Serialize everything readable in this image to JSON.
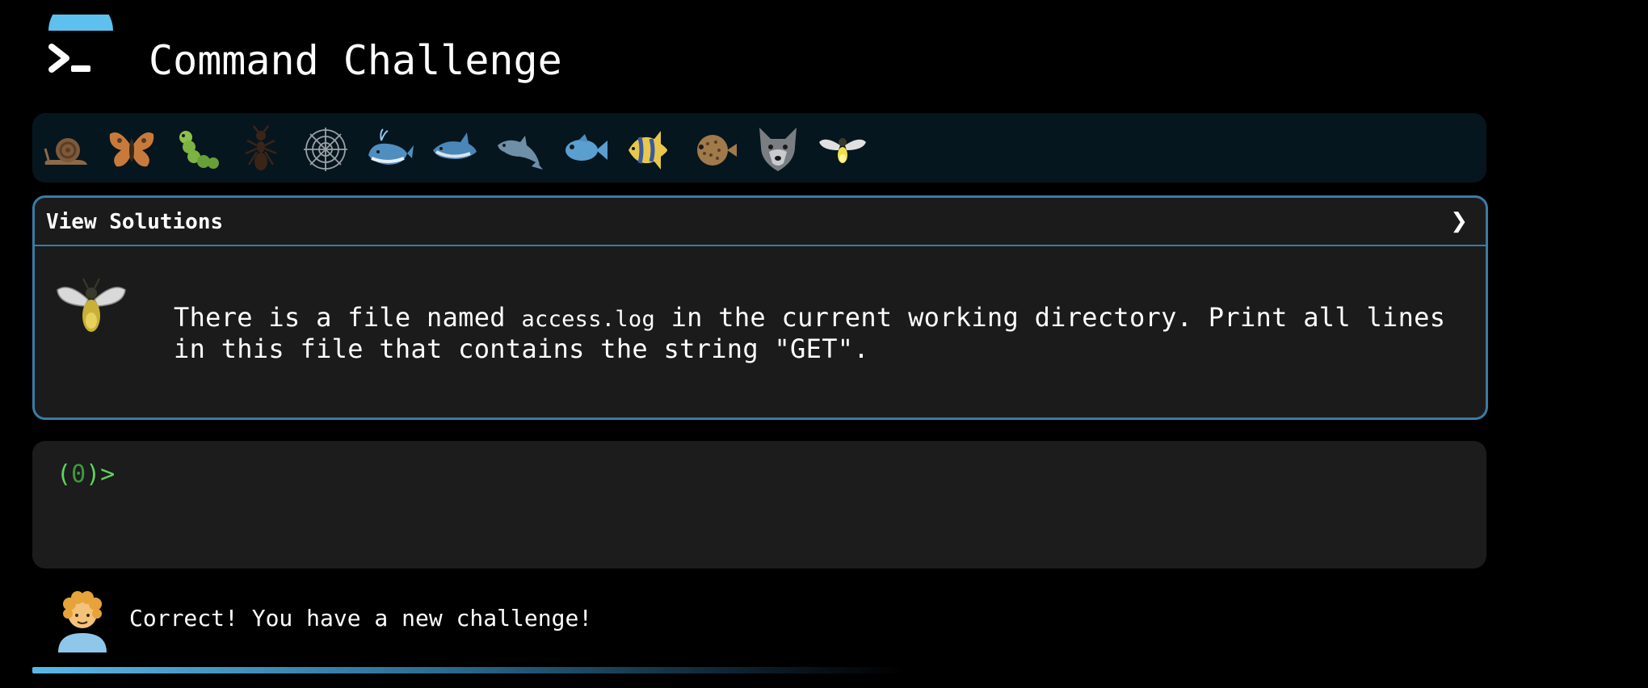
{
  "header": {
    "title": "Command Challenge",
    "logo_icon": "terminal-prompt-icon"
  },
  "badges": [
    {
      "name": "snail",
      "icon": "snail-icon"
    },
    {
      "name": "butterfly",
      "icon": "butterfly-icon"
    },
    {
      "name": "caterpillar",
      "icon": "caterpillar-icon"
    },
    {
      "name": "ant",
      "icon": "ant-icon"
    },
    {
      "name": "spider-web",
      "icon": "spider-web-icon"
    },
    {
      "name": "whale",
      "icon": "whale-icon"
    },
    {
      "name": "shark",
      "icon": "shark-icon"
    },
    {
      "name": "dolphin",
      "icon": "dolphin-icon"
    },
    {
      "name": "fish",
      "icon": "fish-icon"
    },
    {
      "name": "tropical-fish",
      "icon": "tropical-fish-icon"
    },
    {
      "name": "blowfish",
      "icon": "blowfish-icon"
    },
    {
      "name": "wolf",
      "icon": "wolf-icon"
    },
    {
      "name": "firefly",
      "icon": "firefly-icon"
    }
  ],
  "solutions": {
    "label": "View Solutions",
    "chevron": "❯",
    "challenge_icon": "firefly-icon",
    "challenge_prefix": "There is a file named ",
    "challenge_code": "access.log",
    "challenge_suffix": " in the current working directory. Print all lines in this file that contains the string \"GET\"."
  },
  "terminal": {
    "prompt_open": "(",
    "prompt_count": "0",
    "prompt_close": ")>",
    "input_value": ""
  },
  "message": {
    "avatar_icon": "person-curly-hair-icon",
    "text": "Correct! You have a new challenge!"
  },
  "progress": {
    "value": 0.6
  },
  "colors": {
    "background": "#000000",
    "panel": "#1b1b1b",
    "accent_border": "#3a7ba6",
    "prompt_green": "#5bd65b",
    "progress_start": "#5ab8e8"
  }
}
